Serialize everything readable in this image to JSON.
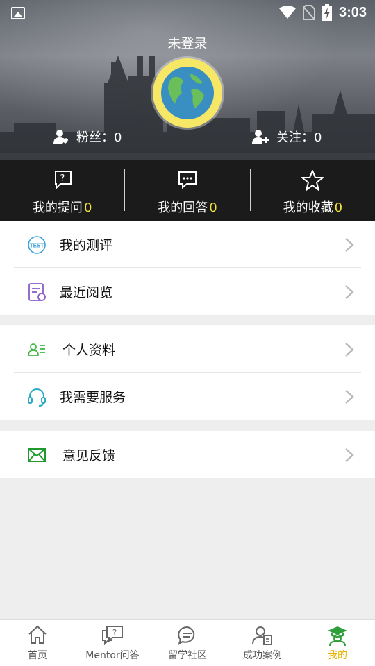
{
  "status": {
    "time": "3:03"
  },
  "profile": {
    "title": "未登录",
    "fans_label": "粉丝：0",
    "follow_label": "关注：0"
  },
  "qbar": [
    {
      "label": "我的提问",
      "count": "0"
    },
    {
      "label": "我的回答",
      "count": "0"
    },
    {
      "label": "我的收藏",
      "count": "0"
    }
  ],
  "menu": {
    "group1": [
      {
        "label": "我的测评"
      },
      {
        "label": "最近阅览"
      }
    ],
    "group2": [
      {
        "label": "个人资料"
      },
      {
        "label": "我需要服务"
      }
    ],
    "group3": [
      {
        "label": "意见反馈"
      }
    ]
  },
  "nav": [
    {
      "label": "首页"
    },
    {
      "label": "Mentor问答"
    },
    {
      "label": "留学社区"
    },
    {
      "label": "成功案例"
    },
    {
      "label": "我的"
    }
  ],
  "colors": {
    "accent": "#e8b200",
    "count_yellow": "#f2e23a",
    "bar_bg": "#1b1b1b"
  }
}
